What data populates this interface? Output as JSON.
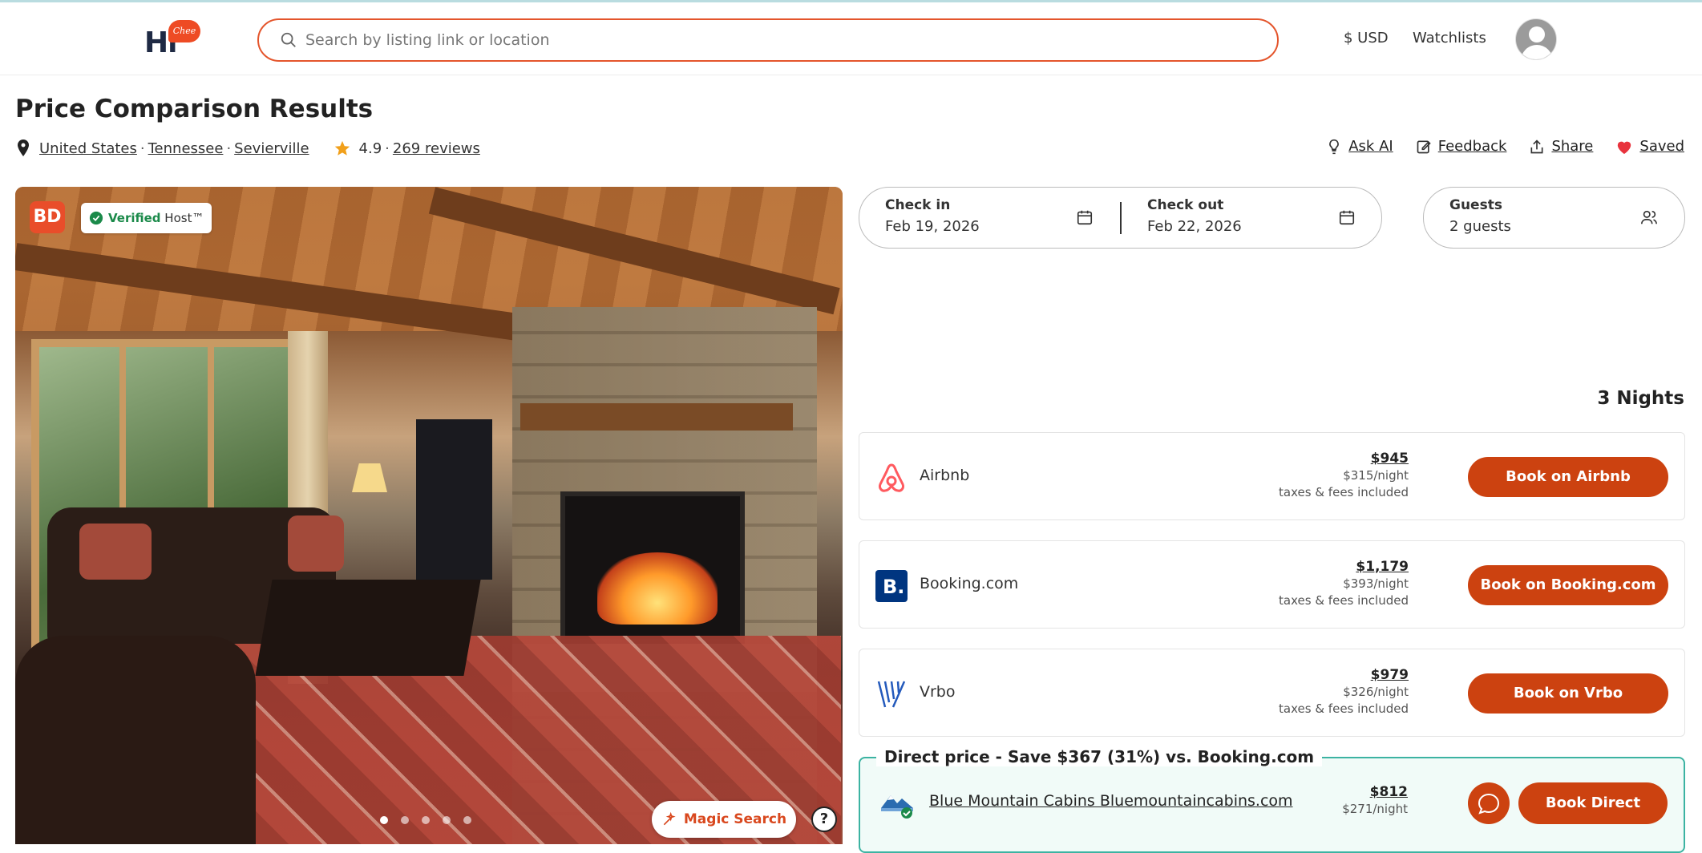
{
  "header": {
    "logo_text": "Hi",
    "logo_bubble": "Chee",
    "search_placeholder": "Search by listing link or location",
    "currency": "$ USD",
    "watchlists": "Watchlists"
  },
  "page": {
    "title": "Price Comparison Results",
    "location": [
      "United States",
      "Tennessee",
      "Sevierville"
    ],
    "rating": "4.9",
    "reviews": "269 reviews",
    "actions": {
      "ask_ai": "Ask AI",
      "feedback": "Feedback",
      "share": "Share",
      "saved": "Saved"
    }
  },
  "photo": {
    "host_badge": "BD",
    "verified_word": "Verified",
    "verified_rest": " Host™",
    "magic_search": "Magic Search",
    "help": "?",
    "carousel_count": 5,
    "carousel_active": 1
  },
  "booking": {
    "check_in_label": "Check in",
    "check_in_value": "Feb 19, 2026",
    "check_out_label": "Check out",
    "check_out_value": "Feb 22, 2026",
    "guests_label": "Guests",
    "guests_value": "2 guests",
    "nights": "3 Nights"
  },
  "offers": [
    {
      "name": "Airbnb",
      "total": "$945",
      "per_night": "$315/night",
      "note": "taxes & fees included",
      "button": "Book on Airbnb",
      "icon": "airbnb-icon",
      "color": "#ff5a5f"
    },
    {
      "name": "Booking.com",
      "total": "$1,179",
      "per_night": "$393/night",
      "note": "taxes & fees included",
      "button": "Book on Booking.com",
      "icon": "booking-icon",
      "color": "#003580"
    },
    {
      "name": "Vrbo",
      "total": "$979",
      "per_night": "$326/night",
      "note": "taxes & fees included",
      "button": "Book on Vrbo",
      "icon": "vrbo-icon",
      "color": "#245abc"
    }
  ],
  "direct": {
    "legend": "Direct price - Save $367 (31%) vs. Booking.com",
    "name": "Blue Mountain Cabins Bluemountaincabins.com",
    "total": "$812",
    "per_night": "$271/night",
    "button": "Book Direct"
  },
  "colors": {
    "accent": "#cc4210",
    "search_border": "#e4552c",
    "direct_border": "#3cb3a2"
  }
}
